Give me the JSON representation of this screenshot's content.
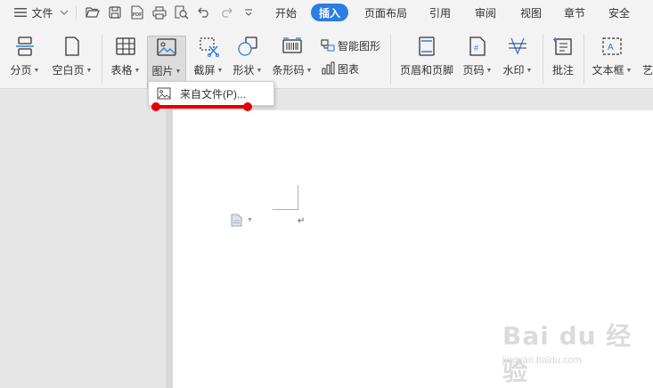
{
  "menu": {
    "file_label": "文件",
    "tabs": [
      "开始",
      "插入",
      "页面布局",
      "引用",
      "审阅",
      "视图",
      "章节",
      "安全"
    ],
    "active_tab": "插入"
  },
  "quick_access": {
    "items": [
      "open-icon",
      "save-icon",
      "pdf-icon",
      "print-icon",
      "print-preview-icon",
      "undo-icon",
      "redo-icon",
      "more-icon"
    ],
    "pdf_text": "PDF"
  },
  "ribbon": {
    "page_break": "分页",
    "blank_page": "空白页",
    "table": "表格",
    "picture": "图片",
    "screenshot": "截屏",
    "shape": "形状",
    "barcode": "条形码",
    "smart_art": "智能图形",
    "chart": "图表",
    "header_footer": "页眉和页脚",
    "page_number": "页码",
    "watermark": "水印",
    "comment": "批注",
    "textbox": "文本框",
    "art_text": "艺"
  },
  "dropdown": {
    "from_file": "来自文件(P)..."
  },
  "document": {
    "paragraph_mark": "↵"
  },
  "watermark": {
    "brand": "Bai du 经验",
    "url": "jingyan.baidu.com"
  },
  "colors": {
    "accent": "#2a7de1",
    "highlight_line": "#e30000"
  }
}
